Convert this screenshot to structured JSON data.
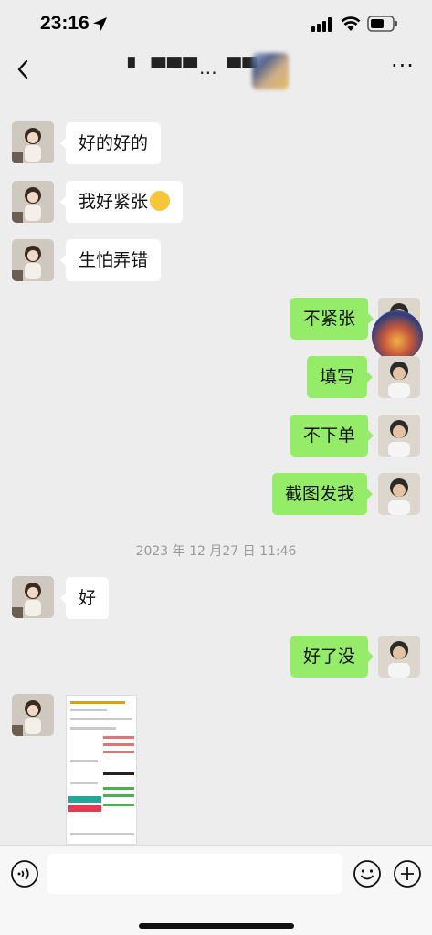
{
  "status_bar": {
    "time": "23:16"
  },
  "header": {
    "title": "▘ ▀▀▀…  ▀▀"
  },
  "messages": [
    {
      "side": "left",
      "text": "好的好的"
    },
    {
      "side": "left",
      "text": "我好紧张",
      "emoji": "grinning-sweat-emoji"
    },
    {
      "side": "left",
      "text": "生怕弄错"
    },
    {
      "side": "right",
      "text": "不紧张"
    },
    {
      "side": "right",
      "text": "填写"
    },
    {
      "side": "right",
      "text": "不下单"
    },
    {
      "side": "right",
      "text": "截图发我"
    },
    {
      "side": "left",
      "text": "好"
    },
    {
      "side": "right",
      "text": "好了没"
    }
  ],
  "timestamp": "2023 年 12 月27 日 11:46",
  "colors": {
    "background": "#ededed",
    "bubble_sent": "#95ec69",
    "bubble_received": "#ffffff"
  },
  "icons": [
    "location-arrow-icon",
    "signal-icon",
    "wifi-icon",
    "battery-icon",
    "back-chevron-icon",
    "more-icon",
    "voice-icon",
    "emoji-icon",
    "plus-icon"
  ]
}
